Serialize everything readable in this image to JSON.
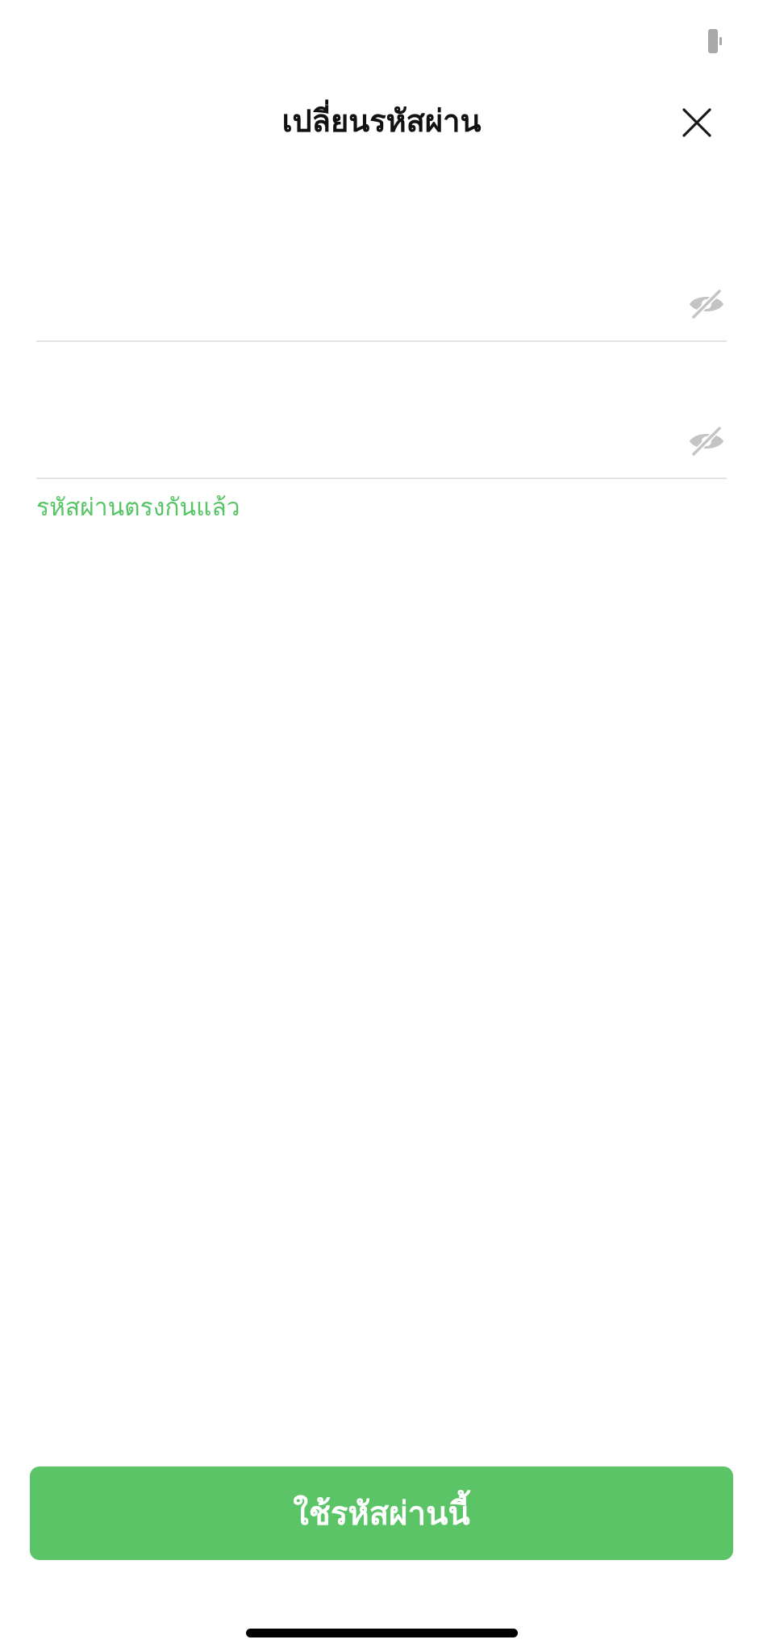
{
  "status_bar": {
    "battery_icon": "battery-icon"
  },
  "header": {
    "title": "เปลี่ยนรหัสผ่าน",
    "close_icon": "close-icon"
  },
  "form": {
    "new_password": {
      "value": "",
      "placeholder": "",
      "visibility_icon": "eye-slash-icon"
    },
    "confirm_password": {
      "value": "",
      "placeholder": "",
      "visibility_icon": "eye-slash-icon"
    },
    "match_message": "รหัสผ่านตรงกันแล้ว"
  },
  "submit": {
    "label": "ใช้รหัสผ่านนี้"
  },
  "colors": {
    "accent": "#5ac467",
    "hint": "#57c466",
    "divider": "#e3e3e3",
    "icon_gray": "#c4c4c4"
  }
}
